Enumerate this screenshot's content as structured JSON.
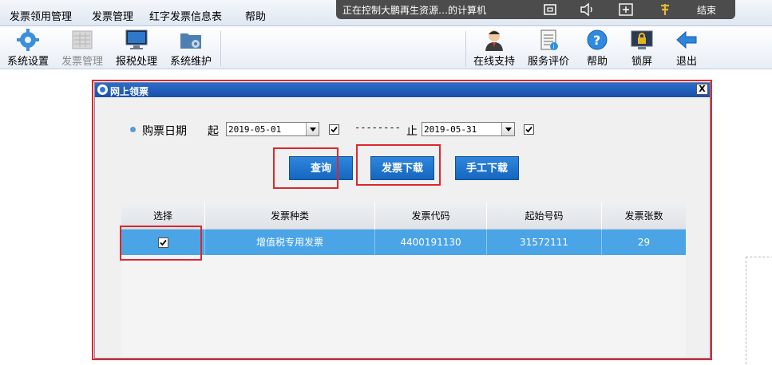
{
  "menubar": {
    "items": [
      "发票领用管理",
      "发票管理",
      "红字发票信息表",
      "帮助"
    ]
  },
  "remote": {
    "title": "正在控制大鹏再生资源…的计算机",
    "end_label": "结束"
  },
  "toolbar": {
    "left": [
      {
        "label": "系统设置",
        "icon": "gear-icon"
      },
      {
        "label": "发票管理",
        "icon": "invoice-icon",
        "disabled": true
      },
      {
        "label": "报税处理",
        "icon": "monitor-icon"
      },
      {
        "label": "系统维护",
        "icon": "folder-gear-icon"
      }
    ],
    "right": [
      {
        "label": "在线支持",
        "icon": "support-person-icon"
      },
      {
        "label": "服务评价",
        "icon": "clipboard-icon"
      },
      {
        "label": "帮助",
        "icon": "help-icon"
      },
      {
        "label": "锁屏",
        "icon": "lock-screen-icon"
      },
      {
        "label": "退出",
        "icon": "exit-arrow-icon"
      }
    ]
  },
  "dialog": {
    "title": "网上领票",
    "close_label": "X",
    "date_label": "购票日期",
    "from_label": "起",
    "from_value": "2019-05-01",
    "separator": "--------",
    "to_label": "止",
    "to_value": "2019-05-31",
    "buttons": {
      "query": "查询",
      "download": "发票下载",
      "manual_download": "手工下载"
    },
    "columns": [
      "选择",
      "发票种类",
      "发票代码",
      "起始号码",
      "发票张数"
    ],
    "rows": [
      {
        "selected": true,
        "type": "增值税专用发票",
        "code": "4400191130",
        "start_no": "31572111",
        "count": "29"
      }
    ]
  },
  "colors": {
    "accent_blue": "#1a6fcd",
    "selected_row": "#4aa4e6",
    "annotation_red": "#e0262b"
  }
}
